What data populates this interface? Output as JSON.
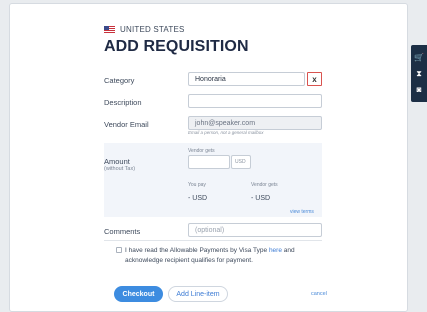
{
  "header": {
    "country": "UNITED STATES",
    "title": "ADD REQUISITION"
  },
  "form": {
    "category": {
      "label": "Category",
      "value": "Honoraria",
      "clear_label": "x"
    },
    "description": {
      "label": "Description",
      "value": ""
    },
    "vendor_email": {
      "label": "Vendor Email",
      "value": "john@speaker.com",
      "hint": "Email a person, not a general mailbox"
    },
    "amount": {
      "label": "Amount",
      "sublabel": "(without Tax)",
      "vendor_gets_label": "Vendor gets",
      "currency": "USD",
      "you_pay_label": "You pay",
      "you_pay_value": "- USD",
      "vendor_gets_value_label": "Vendor gets",
      "vendor_gets_value": "- USD",
      "view_terms": "view terms"
    },
    "comments": {
      "label": "Comments",
      "placeholder": "(optional)"
    },
    "ack": {
      "text_before": "I have read the Allowable Payments by Visa Type ",
      "link": "here",
      "text_after": " and acknowledge recipient qualifies for payment."
    }
  },
  "actions": {
    "checkout": "Checkout",
    "add_line_item": "Add Line-item",
    "cancel": "cancel"
  },
  "side_toolbar": {
    "icons": [
      "cart-icon",
      "hourglass-icon",
      "briefcase-icon"
    ],
    "glyphs": [
      "🛒",
      "⧗",
      "◙"
    ]
  }
}
